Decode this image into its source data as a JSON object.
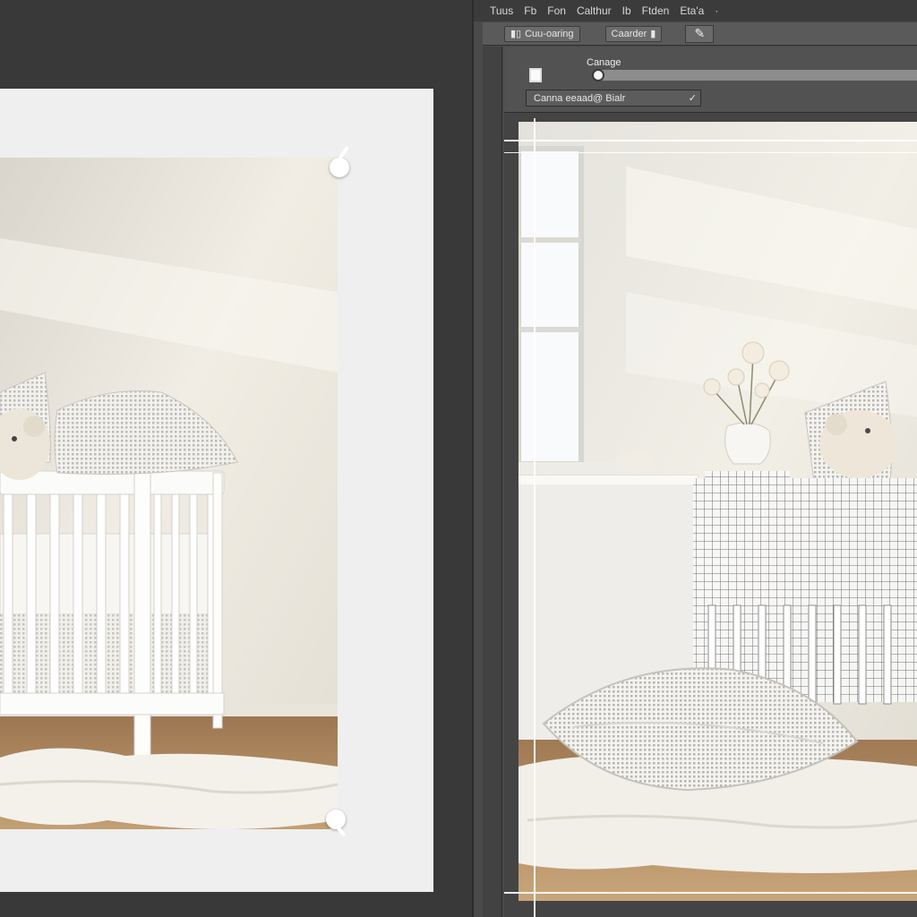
{
  "menu": [
    "Tuus",
    "Fb",
    "Fon",
    "Calthur",
    "Ib",
    "Ftden",
    "Eta'a"
  ],
  "toolbar": {
    "field_left": "Cuu-oaring",
    "field_right": "Caarder",
    "tool_icon": "pen-tool-icon"
  },
  "options": {
    "label": "Canage",
    "select_value": "Canna eeaad@ Bialr",
    "select_check": "✓",
    "checkbox_checked": false,
    "slider_value": 0
  },
  "colors": {
    "panel": "#4a4a4a",
    "menubar": "#3b3b3b",
    "paper": "#efefef",
    "wall": "#ebe7dc",
    "floor": "#b58f63",
    "rug": "#efebe4"
  }
}
